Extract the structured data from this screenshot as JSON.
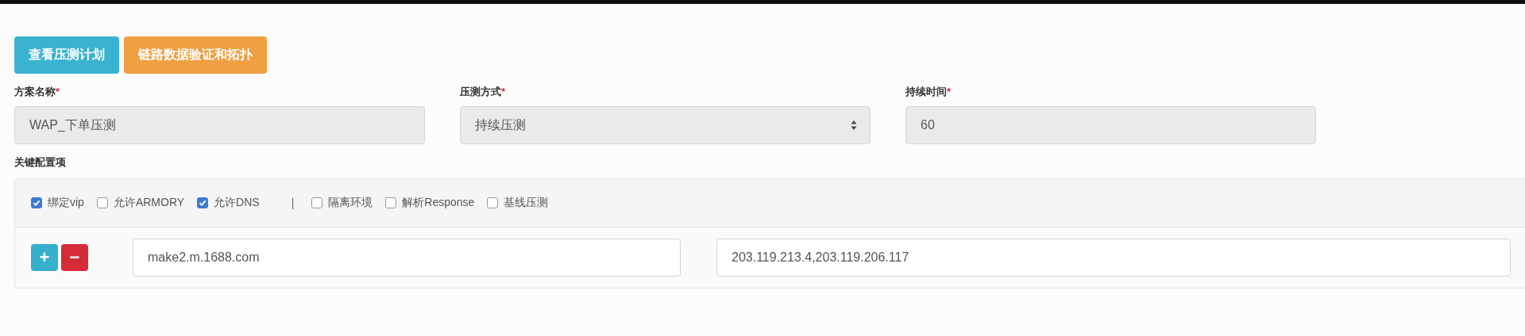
{
  "actions": [
    {
      "label": "查看压测计划",
      "kind": "info"
    },
    {
      "label": "链路数据验证和拓扑",
      "kind": "warning"
    }
  ],
  "fields": [
    {
      "label": "方案名称",
      "required_mark": "*",
      "kind": "text",
      "value": "WAP_下单压测"
    },
    {
      "label": "压测方式",
      "required_mark": "*",
      "kind": "select",
      "value": "持续压测"
    },
    {
      "label": "持续时间",
      "required_mark": "*",
      "kind": "text",
      "value": "60"
    }
  ],
  "config": {
    "title": "关键配置项",
    "options": [
      {
        "kind": "checkbox",
        "label": "绑定vip",
        "checked": true
      },
      {
        "kind": "checkbox",
        "label": "允许ARMORY",
        "checked": false
      },
      {
        "kind": "checkbox",
        "label": "允许DNS",
        "checked": true
      },
      {
        "kind": "separator",
        "label": "|"
      },
      {
        "kind": "checkbox",
        "label": "隔离环境",
        "checked": false
      },
      {
        "kind": "checkbox",
        "label": "解析Response",
        "checked": false
      },
      {
        "kind": "checkbox",
        "label": "基线压测",
        "checked": false
      }
    ],
    "rows": [
      {
        "add": "+",
        "remove": "−",
        "host": "make2.m.1688.com",
        "ips": "203.119.213.4,203.119.206.117"
      }
    ]
  }
}
